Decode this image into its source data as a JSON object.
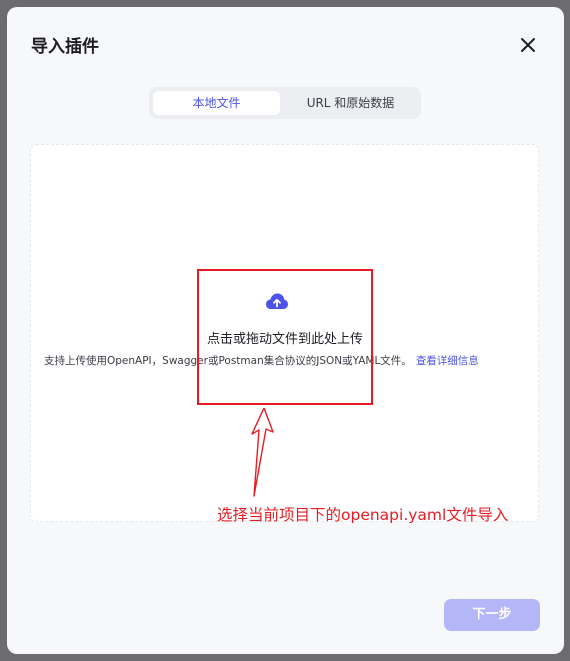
{
  "dialog": {
    "title": "导入插件",
    "close_icon": "close-icon"
  },
  "tabs": [
    {
      "label": "本地文件",
      "active": true
    },
    {
      "label": "URL 和原始数据",
      "active": false
    }
  ],
  "dropzone": {
    "icon": "cloud-upload-icon",
    "main_text": "点击或拖动文件到此处上传",
    "hint_text": "支持上传使用OpenAPI，Swagger或Postman集合协议的JSON或YAML文件。",
    "hint_link": "查看详细信息"
  },
  "annotation": {
    "text": "选择当前项目下的openapi.yaml文件导入",
    "color": "#e51c23"
  },
  "footer": {
    "next_label": "下一步",
    "next_enabled": false
  },
  "colors": {
    "accent": "#4d53e8",
    "disabled_button": "#b4b7f7"
  }
}
